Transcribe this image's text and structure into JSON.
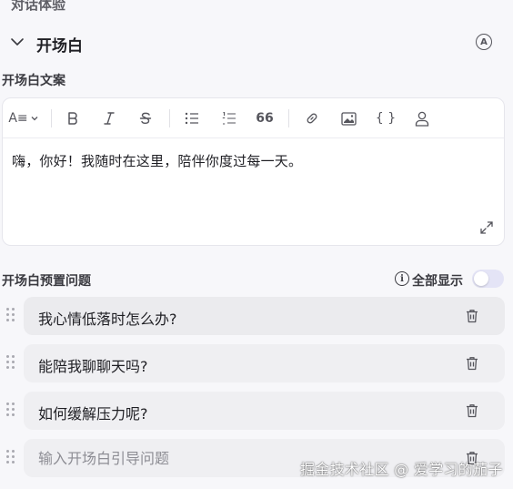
{
  "section": {
    "title": "对话体验"
  },
  "opening": {
    "title": "开场白",
    "badge": "A",
    "copy_label": "开场白文案",
    "editor_text": "嗨，你好！我随时在这里，陪伴你度过每一天。",
    "toolbar": {
      "heading_label": "A≡",
      "quote_label": "66",
      "code_label": "{ }",
      "items": [
        "text-style-icon",
        "bold-icon",
        "italic-icon",
        "strikethrough-icon",
        "bullet-list-icon",
        "numbered-list-icon",
        "quote-icon",
        "link-icon",
        "image-icon",
        "code-braces-icon",
        "user-icon"
      ]
    }
  },
  "presets": {
    "label": "开场白预置问题",
    "info_glyph": "i",
    "show_all_label": "全部显示",
    "show_all_enabled": false,
    "questions": [
      {
        "text": "我心情低落时怎么办?"
      },
      {
        "text": "能陪我聊聊天吗?"
      },
      {
        "text": "如何缓解压力呢?"
      }
    ],
    "new_question_placeholder": "输入开场白引导问题"
  },
  "watermark": "掘金技术社区 @ 爱学习的茄子",
  "colors": {
    "background": "#f7f7fa",
    "card": "#ffffff",
    "row": "#efeff2",
    "toggle_off": "#e4e4f6"
  }
}
